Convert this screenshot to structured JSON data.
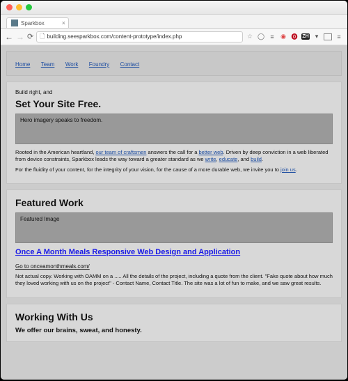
{
  "browser": {
    "tab_title": "Sparkbox",
    "url": "building.seesparkbox.com/content-prototype/index.php"
  },
  "nav": {
    "home": "Home",
    "team": "Team",
    "work": "Work",
    "foundry": "Foundry",
    "contact": "Contact"
  },
  "hero": {
    "lead": "Build right, and",
    "heading": "Set Your Site Free.",
    "placeholder": "Hero imagery speaks to freedom.",
    "p1_pre": "Rooted in the American heartland, ",
    "p1_link1": "our team of craftsmen",
    "p1_mid1": " answers the call for a ",
    "p1_link2": "better web",
    "p1_mid2": ". Driven by deep conviction in a web liberated from device constraints, Sparkbox leads the way toward a greater standard as we ",
    "p1_link3": "write",
    "p1_sep1": ", ",
    "p1_link4": "educate",
    "p1_sep2": ", and ",
    "p1_link5": "build",
    "p1_end": ".",
    "p2_pre": "For the fluidity of your content, for the integrity of your vision, for the cause of a more durable web, we invite you to ",
    "p2_link": "join us",
    "p2_end": "."
  },
  "work": {
    "heading": "Featured Work",
    "placeholder": "Featured Image",
    "project_title": "Once A Month Meals Responsive Web Design and Application",
    "goto": "Go to onceamonthmeals.com/",
    "desc": "Not actual copy. Working with OAMM on a ..... All the details of the project, including a quote from the client. \"Fake quote about how much they loved working with us on the project\" - Contact Name, Contact Title. The site was a lot of fun to make, and we saw great results."
  },
  "withus": {
    "heading": "Working With Us",
    "sub": "We offer our brains, sweat, and honesty."
  },
  "icons": {
    "zh": "ZH"
  }
}
